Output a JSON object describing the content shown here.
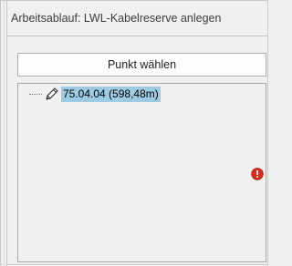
{
  "workflow": {
    "title": "Arbeitsablauf: LWL-Kabelreserve anlegen"
  },
  "pick_button": {
    "label": "Punkt wählen"
  },
  "tree": {
    "nodes": [
      {
        "label": "75.04.04 (598,48m)",
        "icon": "pencil-icon",
        "selected": true
      }
    ]
  },
  "status": {
    "icon": "error-icon",
    "color": "#e02a1a"
  },
  "colors": {
    "selection": "#9ccbe3",
    "background": "#f0f0f0"
  }
}
